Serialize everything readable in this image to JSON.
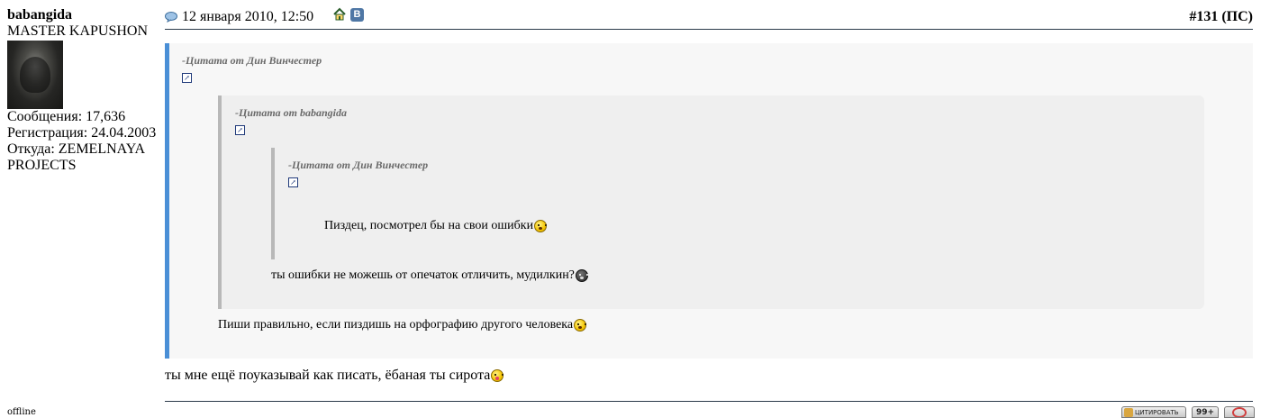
{
  "user": {
    "name": "babangida",
    "title": "MASTER KAPUSHON",
    "posts": "Сообщения: 17,636",
    "registered": "Регистрация: 24.04.2003",
    "location_line1": "Откуда: ZEMELNAYA",
    "location_line2": "PROJECTS",
    "status": "offline"
  },
  "post": {
    "date": "12 января 2010, 12:50",
    "number": "#131",
    "number_suffix": "(ПС)",
    "vk_label": "В",
    "message": "ты мне ещё поуказывай как писать, ёбаная ты сирота"
  },
  "quotes": {
    "outer": {
      "title": "-Цитата от Дин Винчестер",
      "text": "Пиши правильно, если пиздишь на орфографию другого человека"
    },
    "middle": {
      "title": "-Цитата от babangida",
      "text": "ты ошибки не можешь от опечаток отличить, мудилкин?"
    },
    "inner": {
      "title": "-Цитата от Дин Винчестер",
      "text": "Пиздец, посмотрел бы на свои ошибки"
    }
  },
  "buttons": {
    "quote_label": "ЦИТИРОВАТЬ",
    "multiquote_label": "99+"
  },
  "colors": {
    "quote_accent": "#4a8fd6",
    "nested_quote_border": "#b8b8b8",
    "divider": "#2b3a4a"
  }
}
